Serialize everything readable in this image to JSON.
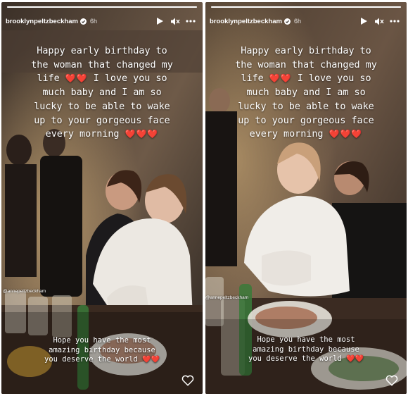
{
  "stories": [
    {
      "username": "brooklynpeltzbeckham",
      "age": "6h",
      "caption_lines": [
        "Happy early birthday to",
        "the woman that changed my",
        "life",
        "I love you so",
        "much baby and I am so",
        "lucky to be able to wake",
        "up to your gorgeous face",
        "every morning"
      ],
      "hearts_life": "❤️❤️",
      "hearts_morning": "❤️❤️❤️",
      "tag": "@annepeltzbeckham",
      "bottom_lines": [
        "Hope you have the most",
        "amazing birthday because",
        "you deserve the world"
      ],
      "bottom_hearts": "❤️❤️",
      "progress": 1.0
    },
    {
      "username": "brooklynpeltzbeckham",
      "age": "6h",
      "caption_lines": [
        "Happy early birthday to",
        "the woman that changed my",
        "life",
        "I love you so",
        "much baby and I am so",
        "lucky to be able to wake",
        "up to your gorgeous face",
        "every morning"
      ],
      "hearts_life": "❤️❤️",
      "hearts_morning": "❤️❤️❤️",
      "tag": "@annepeltzbeckham",
      "bottom_lines": [
        "Hope you have the most",
        "amazing birthday because",
        "you deserve the world"
      ],
      "bottom_hearts": "❤️❤️",
      "progress": 1.0
    }
  ],
  "icons": {
    "verified": "verified-badge-icon",
    "play": "play-icon",
    "mute": "muted-speaker-icon",
    "more": "more-dots-icon",
    "like": "heart-outline-icon"
  },
  "colors": {
    "heart_red": "#e0323a",
    "text_white": "#ffffff"
  }
}
